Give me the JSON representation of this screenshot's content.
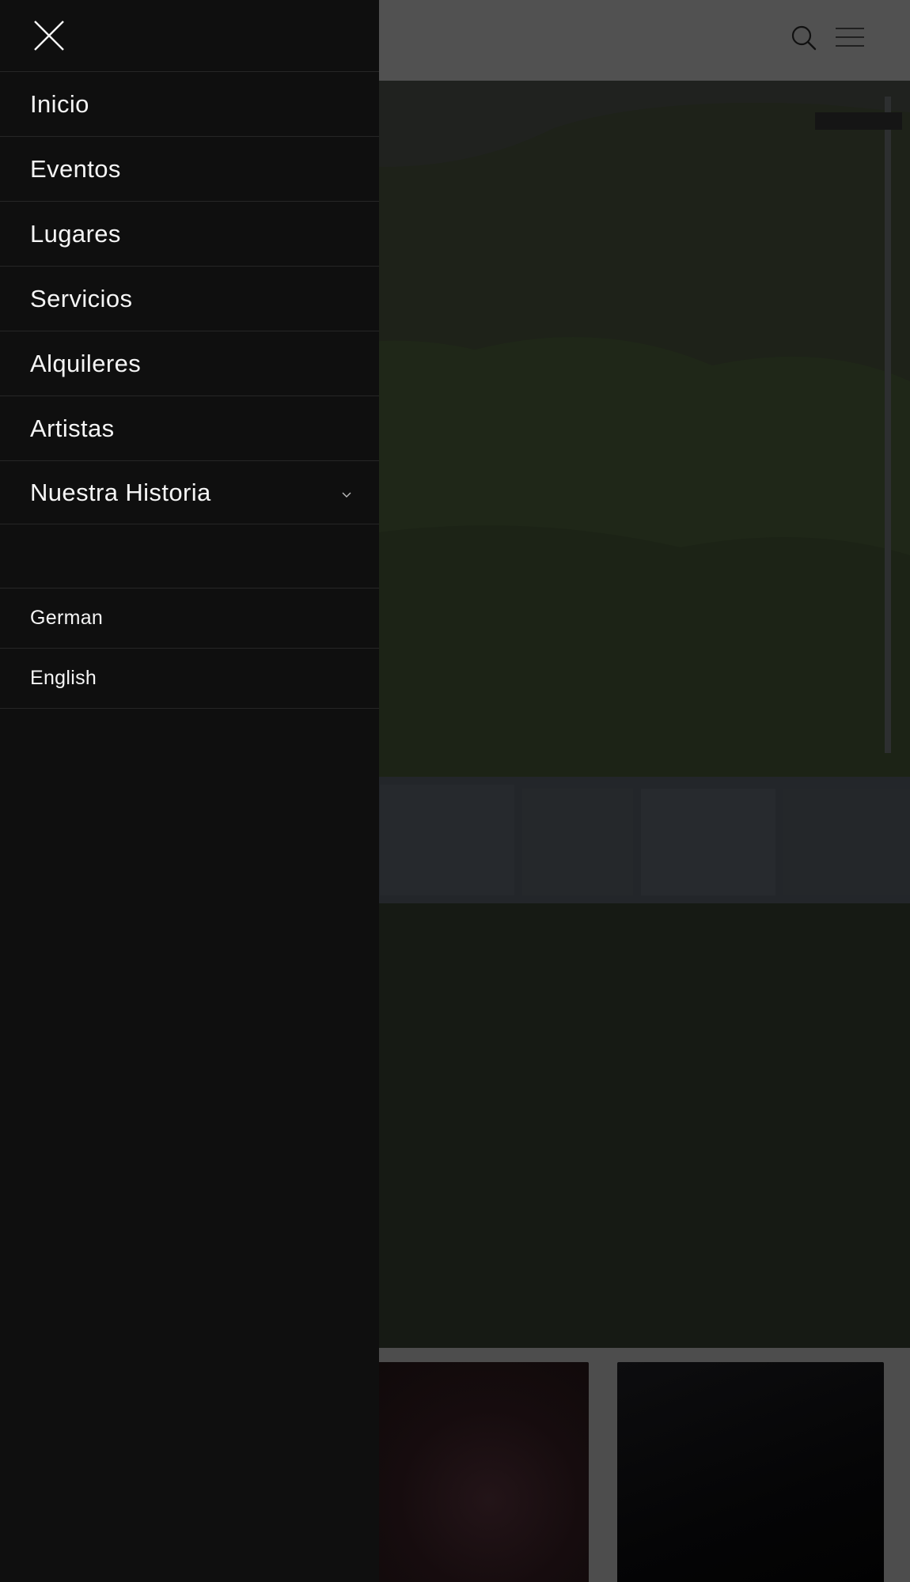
{
  "drawer": {
    "close_icon": "close-icon",
    "menu_items": [
      {
        "label": "Inicio"
      },
      {
        "label": "Eventos"
      },
      {
        "label": "Lugares"
      },
      {
        "label": "Servicios"
      },
      {
        "label": "Alquileres"
      },
      {
        "label": "Artistas"
      },
      {
        "label": "Nuestra Historia",
        "has_submenu": true,
        "icon": "chevron-down-icon"
      }
    ],
    "languages": [
      {
        "label": "German"
      },
      {
        "label": "English"
      }
    ]
  },
  "header": {
    "icons": [
      "search-icon",
      "hamburger-menu-icon"
    ]
  },
  "colors": {
    "drawer_background": "#0f0f0f",
    "header_background": "#515151",
    "text": "#f5f5f5",
    "divider": "#262626"
  }
}
